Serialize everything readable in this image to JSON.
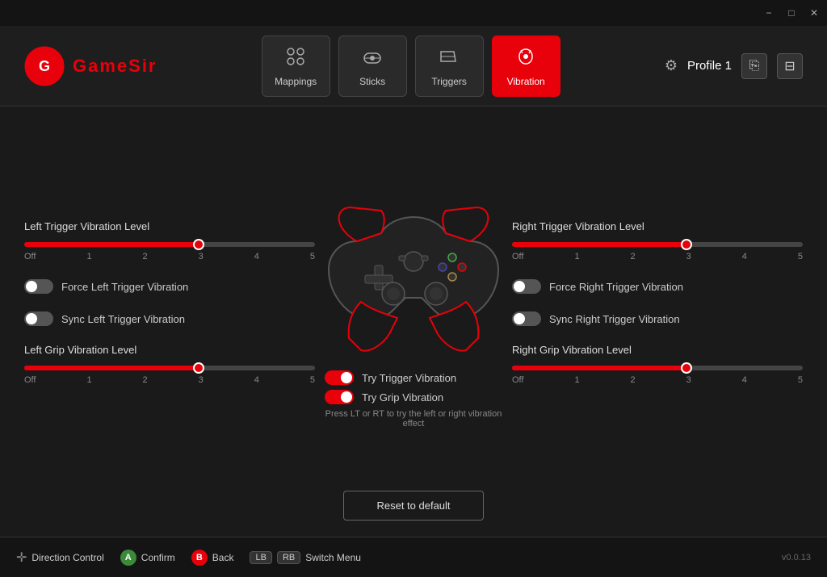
{
  "app": {
    "title": "GameSir",
    "version": "v0.0.13"
  },
  "titlebar": {
    "minimize_label": "−",
    "maximize_label": "□",
    "close_label": "✕"
  },
  "nav": {
    "tabs": [
      {
        "id": "mappings",
        "label": "Mappings",
        "icon": "⊞",
        "active": false
      },
      {
        "id": "sticks",
        "label": "Sticks",
        "icon": "◎",
        "active": false
      },
      {
        "id": "triggers",
        "label": "Triggers",
        "icon": "◣",
        "active": false
      },
      {
        "id": "vibration",
        "label": "Vibration",
        "icon": "🎮",
        "active": true
      }
    ]
  },
  "profile": {
    "label": "Profile 1",
    "save_icon": "⎘",
    "export_icon": "⊟"
  },
  "left": {
    "trigger_section": {
      "label": "Left Trigger Vibration Level",
      "slider_value": 3,
      "slider_max": 5,
      "slider_labels": [
        "Off",
        "1",
        "2",
        "3",
        "4",
        "5"
      ]
    },
    "force_trigger": {
      "label": "Force Left Trigger Vibration",
      "on": false
    },
    "sync_trigger": {
      "label": "Sync Left Trigger Vibration",
      "on": false
    },
    "grip_section": {
      "label": "Left Grip Vibration Level",
      "slider_value": 3,
      "slider_max": 5,
      "slider_labels": [
        "Off",
        "1",
        "2",
        "3",
        "4",
        "5"
      ]
    }
  },
  "right": {
    "trigger_section": {
      "label": "Right Trigger Vibration Level",
      "slider_value": 3,
      "slider_max": 5,
      "slider_labels": [
        "Off",
        "1",
        "2",
        "3",
        "4",
        "5"
      ]
    },
    "force_trigger": {
      "label": "Force Right Trigger Vibration",
      "on": false
    },
    "sync_trigger": {
      "label": "Sync Right Trigger Vibration",
      "on": false
    },
    "grip_section": {
      "label": "Right Grip Vibration Level",
      "slider_value": 3,
      "slider_max": 5,
      "slider_labels": [
        "Off",
        "1",
        "2",
        "3",
        "4",
        "5"
      ]
    }
  },
  "center": {
    "try_trigger": {
      "label": "Try Trigger Vibration",
      "on": true
    },
    "try_grip": {
      "label": "Try Grip Vibration",
      "on": true
    },
    "hint": "Press LT or RT to try the left or right vibration effect"
  },
  "reset": {
    "label": "Reset to default"
  },
  "footer": {
    "direction_label": "Direction Control",
    "confirm_label": "Confirm",
    "confirm_btn": "A",
    "back_label": "Back",
    "back_btn": "B",
    "lb_label": "LB",
    "rb_label": "RB",
    "switch_label": "Switch Menu"
  }
}
